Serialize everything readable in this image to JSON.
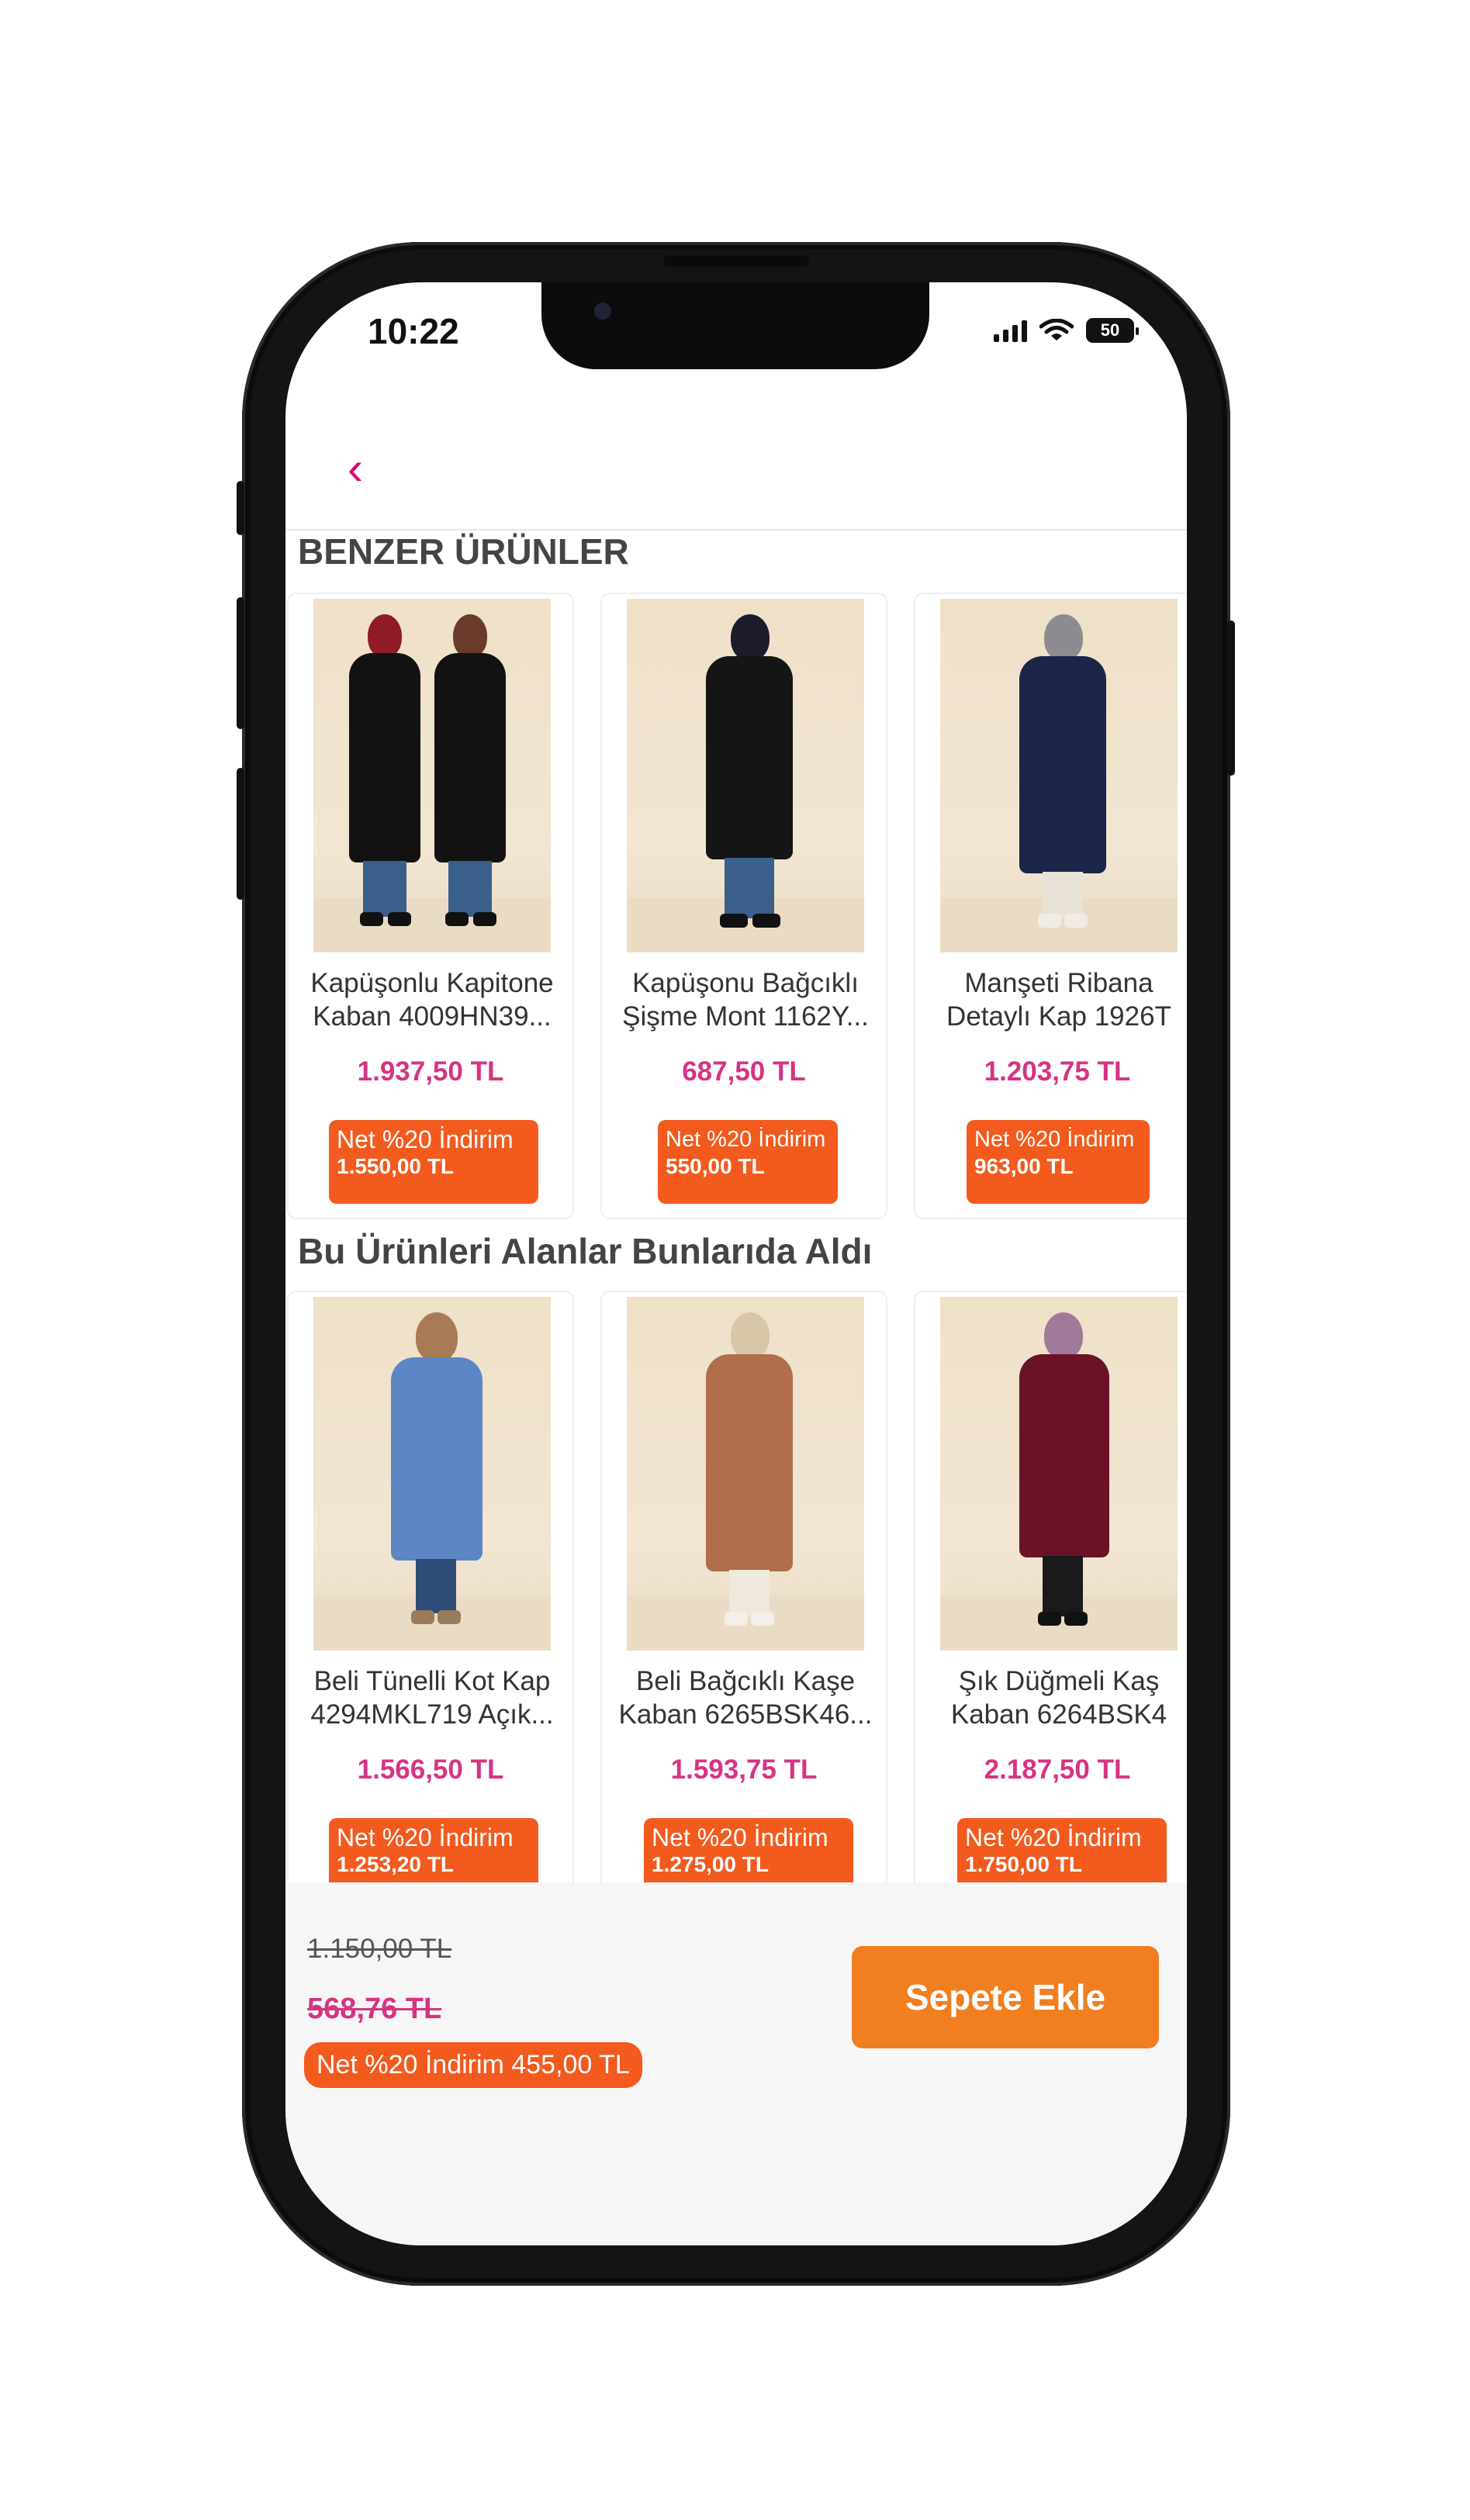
{
  "status_bar": {
    "time": "10:22",
    "battery": "50"
  },
  "sections": {
    "similar_title": "BENZER ÜRÜNLER",
    "also_bought_title": "Bu Ürünleri Alanlar Bunlarıda Aldı"
  },
  "similar_products": [
    {
      "name": "Kapüşonlu Kapitone\nKaban 4009HN39...",
      "price": "1.937,50 TL",
      "discount_label": "Net %20 İndirim",
      "discount_price": "1.550,00 TL",
      "coat_color": "#121212"
    },
    {
      "name": "Kapüşonu Bağcıklı\nŞişme Mont 1162Y...",
      "price": "687,50 TL",
      "discount_label": "Net %20 İndirim",
      "discount_price": "550,00 TL",
      "coat_color": "#151515"
    },
    {
      "name": "Manşeti Ribana\nDetaylı Kap 1926T",
      "price": "1.203,75 TL",
      "discount_label": "Net %20 İndirim",
      "discount_price": "963,00 TL",
      "coat_color": "#1c2547"
    }
  ],
  "also_bought_products": [
    {
      "name": "Beli Tünelli Kot Kap\n4294MKL719 Açık...",
      "price": "1.566,50 TL",
      "discount_label": "Net %20 İndirim",
      "discount_price": "1.253,20 TL",
      "coat_color": "#5d86c4"
    },
    {
      "name": "Beli Bağcıklı Kaşe\nKaban 6265BSK46...",
      "price": "1.593,75 TL",
      "discount_label": "Net %20 İndirim",
      "discount_price": "1.275,00 TL",
      "coat_color": "#b06e4c"
    },
    {
      "name": "Şık Düğmeli Kaş\nKaban 6264BSK4",
      "price": "2.187,50 TL",
      "discount_label": "Net %20 İndirim",
      "discount_price": "1.750,00 TL",
      "coat_color": "#6a1228"
    }
  ],
  "bottom_bar": {
    "original_price": "1.150,00 TL",
    "sale_price": "568,76 TL",
    "net_discount": "Net %20 İndirim 455,00 TL",
    "add_to_cart": "Sepete Ekle"
  },
  "colors": {
    "accent": "#d63384",
    "discount_bg": "#f25a1e",
    "cart_button": "#f17e1f"
  }
}
